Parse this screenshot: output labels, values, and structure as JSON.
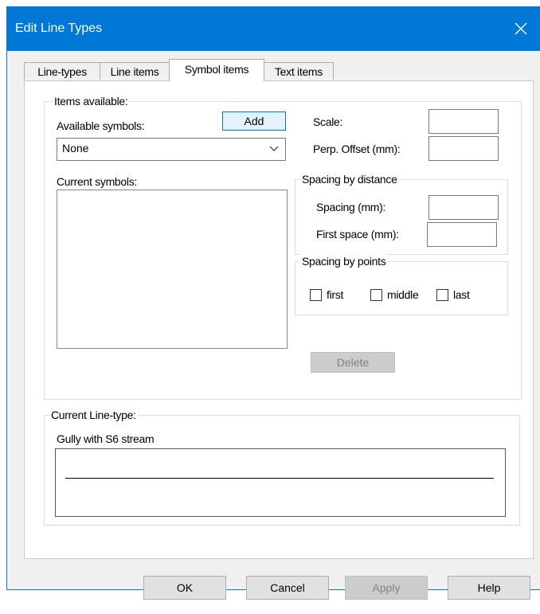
{
  "window": {
    "title": "Edit Line Types"
  },
  "tabs": [
    {
      "label": "Line-types"
    },
    {
      "label": "Line items"
    },
    {
      "label": "Symbol items"
    },
    {
      "label": "Text items"
    }
  ],
  "items_available": {
    "legend": "Items available:",
    "available_symbols_label": "Available symbols:",
    "add_button": "Add",
    "available_symbols_value": "None",
    "current_symbols_label": "Current symbols:",
    "scale_label": "Scale:",
    "perp_offset_label": "Perp. Offset (mm):",
    "delete_button": "Delete"
  },
  "spacing_distance": {
    "legend": "Spacing by distance",
    "spacing_label": "Spacing (mm):",
    "first_space_label": "First space (mm):"
  },
  "spacing_points": {
    "legend": "Spacing by points",
    "first_label": "first",
    "middle_label": "middle",
    "last_label": "last"
  },
  "current_line_type": {
    "legend": "Current Line-type:",
    "name": "Gully with S6 stream"
  },
  "footer": {
    "ok": "OK",
    "cancel": "Cancel",
    "apply": "Apply",
    "help": "Help"
  }
}
